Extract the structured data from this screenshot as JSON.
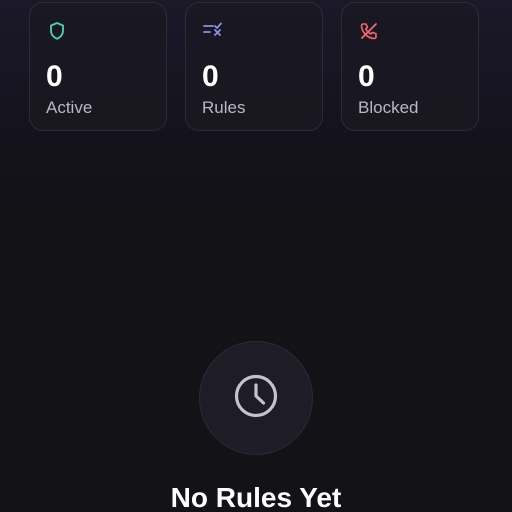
{
  "stats": [
    {
      "icon": "shield-icon",
      "value": "0",
      "label": "Active",
      "color": "#4fd1b0"
    },
    {
      "icon": "rules-list-icon",
      "value": "0",
      "label": "Rules",
      "color": "#8b8fe8"
    },
    {
      "icon": "blocked-call-icon",
      "value": "0",
      "label": "Blocked",
      "color": "#f06a6a"
    }
  ],
  "empty_state": {
    "icon": "clock-icon",
    "title": "No Rules Yet"
  },
  "colors": {
    "background": "#121217",
    "card_border": "#2d2c36",
    "text_primary": "#ffffff",
    "text_secondary": "#b9b8c3",
    "clock": "#c4c3cc"
  }
}
